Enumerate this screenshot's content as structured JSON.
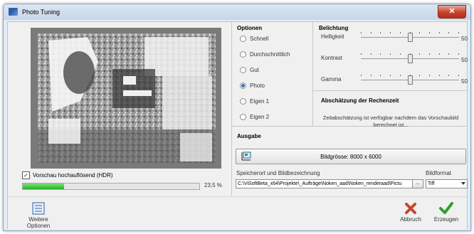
{
  "window": {
    "title": "Photo Tuning",
    "close_label": "✕"
  },
  "preview": {
    "hdr_label": "Vorschau hochauflösend (HDR)",
    "hdr_checked": true,
    "progress_percent": 23.5,
    "progress_text": "23,5 %"
  },
  "optionen": {
    "title": "Optionen",
    "options": [
      {
        "label": "Schnell",
        "selected": false
      },
      {
        "label": "Durchschnittlich",
        "selected": false
      },
      {
        "label": "Gut",
        "selected": false
      },
      {
        "label": "Photo",
        "selected": true
      },
      {
        "label": "Eigen 1",
        "selected": false
      },
      {
        "label": "Eigen 2",
        "selected": false
      }
    ]
  },
  "belichtung": {
    "title": "Belichtung",
    "sliders": [
      {
        "label": "Helligkeit",
        "value": 50,
        "value_text": "50"
      },
      {
        "label": "Kontrast",
        "value": 50,
        "value_text": "50"
      },
      {
        "label": "Gamma",
        "value": 50,
        "value_text": "50"
      }
    ]
  },
  "estimate": {
    "title": "Abschätzung der Rechenzeit",
    "text": "Zeitabschätzung ist verfügbar nachdem das Vorschaubild berechnet ist..."
  },
  "ausgabe": {
    "title": "Ausgabe",
    "size_button_label": "Bildgrösse: 8000 x 6000",
    "path_label": "Speicherort und Bildbezeichnung",
    "path_value": "C:\\ViSoftBeta_x64\\Projekte\\_Aufträge\\Noken_aad\\Noken_renderaad\\Pictu",
    "browse_label": "...",
    "format_label": "Bildformat",
    "format_value": "Tiff"
  },
  "toolbar": {
    "more_options_label_1": "Weitere",
    "more_options_label_2": "Optionen",
    "cancel_label": "Abbruch",
    "create_label": "Erzeugen"
  },
  "colors": {
    "cancel": "#c8462a",
    "create": "#2f9e2f",
    "accent": "#2f6fc4"
  }
}
